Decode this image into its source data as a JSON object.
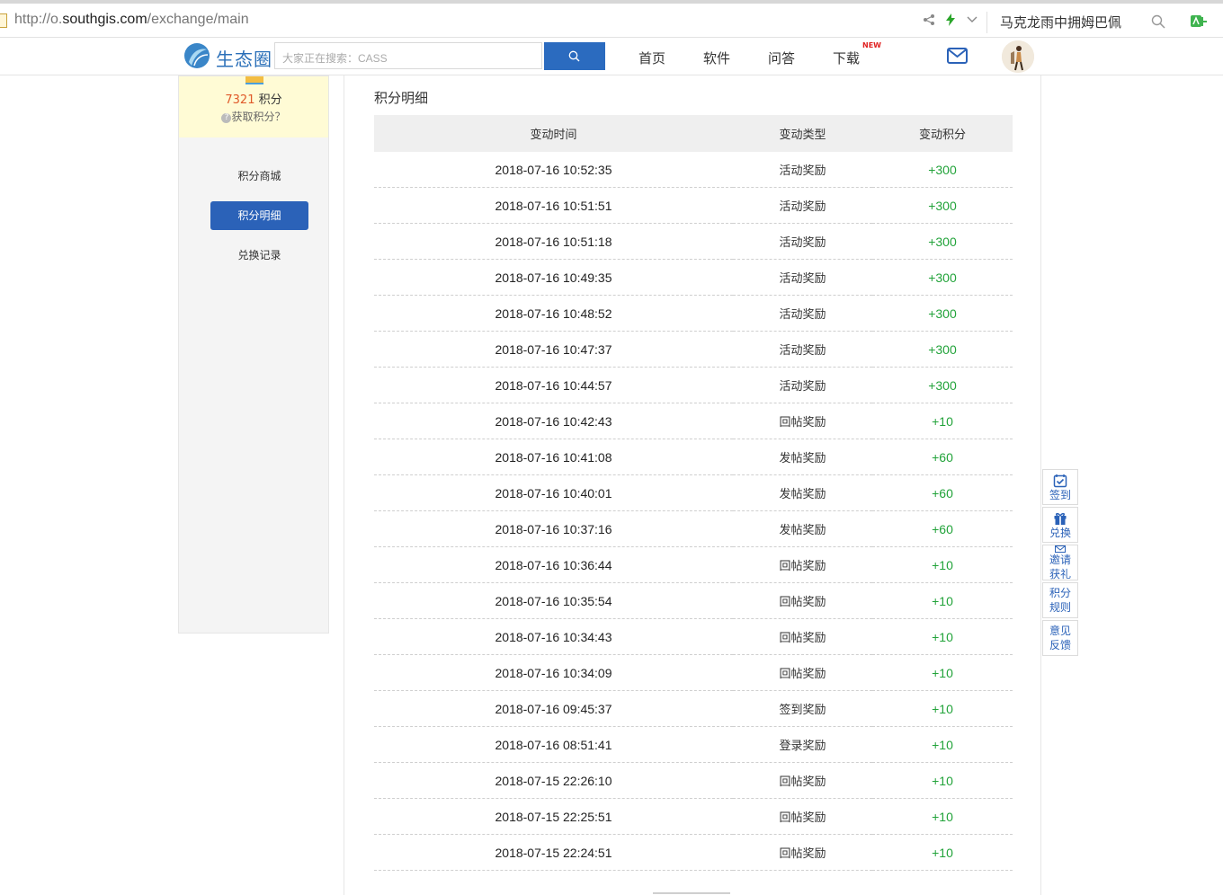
{
  "browser": {
    "url_prefix": "http://o.",
    "url_domain": "southgis.com",
    "url_path": "/exchange/main",
    "search_text": "马克龙雨中拥姆巴佩"
  },
  "header": {
    "logo_text": "生态圈",
    "search_placeholder": "大家正在搜索：CASS",
    "nav": [
      "首页",
      "软件",
      "问答",
      "下载"
    ],
    "new_badge": "NEW"
  },
  "sidebar": {
    "points_value": "7321",
    "points_unit": "积分",
    "get_points": "获取积分？",
    "items": [
      {
        "label": "积分商城",
        "active": false
      },
      {
        "label": "积分明细",
        "active": true
      },
      {
        "label": "兑换记录",
        "active": false
      }
    ]
  },
  "main": {
    "title": "积分明细",
    "columns": [
      "变动时间",
      "变动类型",
      "变动积分"
    ],
    "rows": [
      [
        "2018-07-16 10:52:35",
        "活动奖励",
        "+300"
      ],
      [
        "2018-07-16 10:51:51",
        "活动奖励",
        "+300"
      ],
      [
        "2018-07-16 10:51:18",
        "活动奖励",
        "+300"
      ],
      [
        "2018-07-16 10:49:35",
        "活动奖励",
        "+300"
      ],
      [
        "2018-07-16 10:48:52",
        "活动奖励",
        "+300"
      ],
      [
        "2018-07-16 10:47:37",
        "活动奖励",
        "+300"
      ],
      [
        "2018-07-16 10:44:57",
        "活动奖励",
        "+300"
      ],
      [
        "2018-07-16 10:42:43",
        "回帖奖励",
        "+10"
      ],
      [
        "2018-07-16 10:41:08",
        "发帖奖励",
        "+60"
      ],
      [
        "2018-07-16 10:40:01",
        "发帖奖励",
        "+60"
      ],
      [
        "2018-07-16 10:37:16",
        "发帖奖励",
        "+60"
      ],
      [
        "2018-07-16 10:36:44",
        "回帖奖励",
        "+10"
      ],
      [
        "2018-07-16 10:35:54",
        "回帖奖励",
        "+10"
      ],
      [
        "2018-07-16 10:34:43",
        "回帖奖励",
        "+10"
      ],
      [
        "2018-07-16 10:34:09",
        "回帖奖励",
        "+10"
      ],
      [
        "2018-07-16 09:45:37",
        "签到奖励",
        "+10"
      ],
      [
        "2018-07-16 08:51:41",
        "登录奖励",
        "+10"
      ],
      [
        "2018-07-15 22:26:10",
        "回帖奖励",
        "+10"
      ],
      [
        "2018-07-15 22:25:51",
        "回帖奖励",
        "+10"
      ],
      [
        "2018-07-15 22:24:51",
        "回帖奖励",
        "+10"
      ]
    ]
  },
  "float_toolbar": {
    "items": [
      {
        "line1": "签到",
        "line2": "",
        "icon": "calendar-check-icon"
      },
      {
        "line1": "兑换",
        "line2": "",
        "icon": "gift-icon"
      },
      {
        "line1": "邀请",
        "line2": "获礼",
        "icon": "envelope-icon"
      },
      {
        "line1": "积分",
        "line2": "规则",
        "icon": ""
      },
      {
        "line1": "意见",
        "line2": "反馈",
        "icon": ""
      }
    ]
  },
  "colors": {
    "brand_blue": "#2b62b8",
    "points_green": "#22a33a",
    "points_orange": "#e05a2a"
  }
}
